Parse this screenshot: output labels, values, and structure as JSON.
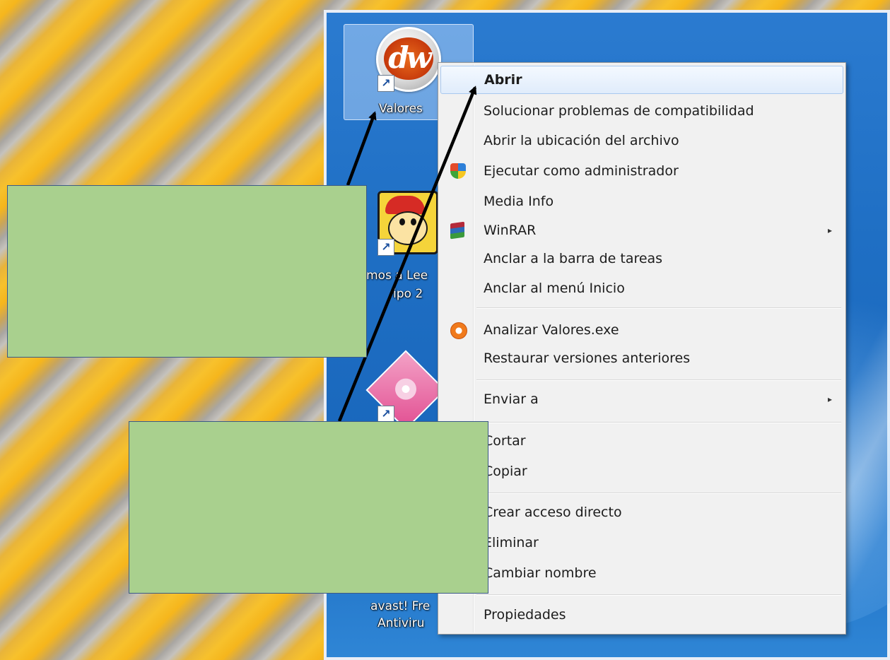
{
  "desktop": {
    "icons": [
      {
        "label": "Valores"
      },
      {
        "label_line1": "mos a Lee",
        "label_line2": "ipo 2"
      },
      {
        "label_line1": "avast! Fre",
        "label_line2": "Antiviru"
      }
    ]
  },
  "context_menu": {
    "items": [
      {
        "label": "Abrir"
      },
      {
        "label": "Solucionar problemas de compatibilidad"
      },
      {
        "label": "Abrir la ubicación del archivo"
      },
      {
        "label": "Ejecutar como administrador"
      },
      {
        "label": "Media Info"
      },
      {
        "label": "WinRAR"
      },
      {
        "label": "Anclar a la barra de tareas"
      },
      {
        "label": "Anclar al menú Inicio"
      },
      {
        "label": "Analizar Valores.exe"
      },
      {
        "label": "Restaurar versiones anteriores"
      },
      {
        "label": "Enviar a"
      },
      {
        "label": "Cortar"
      },
      {
        "label": "Copiar"
      },
      {
        "label": "Crear acceso directo"
      },
      {
        "label": "Eliminar"
      },
      {
        "label": "Cambiar nombre"
      },
      {
        "label": "Propiedades"
      }
    ],
    "submenu_glyph": "▸"
  },
  "app_logo_text": "dw",
  "shortcut_glyph": "↗",
  "icons": {
    "uac": "shield-icon",
    "winrar": "books-icon",
    "avast": "avast-icon"
  },
  "colors": {
    "callout_fill": "#a9d08e",
    "callout_border": "#3c5a86",
    "highlight_border": "#a8c8ef",
    "arrow": "#000000"
  }
}
